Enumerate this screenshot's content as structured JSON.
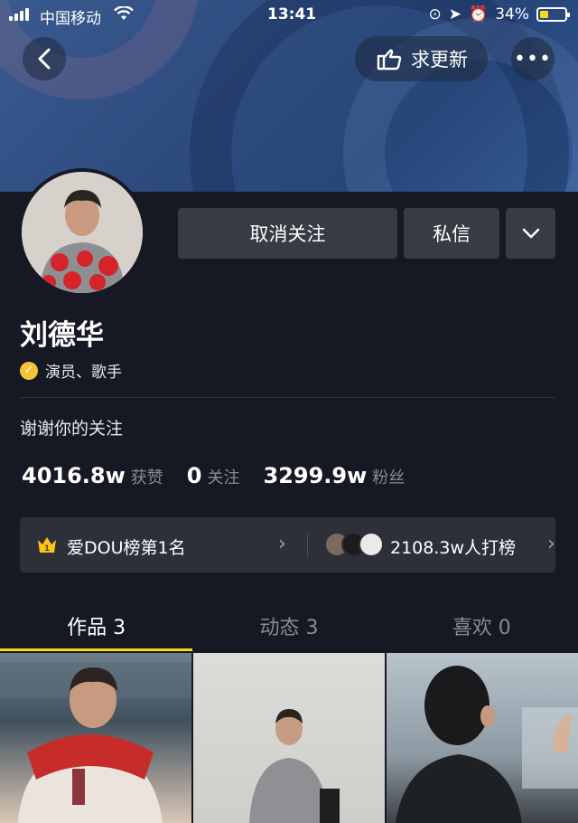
{
  "status_bar": {
    "carrier": "中国移动",
    "time": "13:41",
    "battery": "34%"
  },
  "header": {
    "update_label": "求更新"
  },
  "profile": {
    "name": "刘德华",
    "verified_label": "演员、歌手",
    "bio": "谢谢你的关注",
    "unfollow_label": "取消关注",
    "message_label": "私信"
  },
  "stats": [
    {
      "num": "4016.8w",
      "label": "获赞"
    },
    {
      "num": "0",
      "label": "关注"
    },
    {
      "num": "3299.9w",
      "label": "粉丝"
    }
  ],
  "rank": {
    "left_label": "爱DOU榜第1名",
    "crown_number": "1",
    "right_label": "2108.3w人打榜"
  },
  "tabs": [
    {
      "label": "作品 3",
      "active": true
    },
    {
      "label": "动态 3",
      "active": false
    },
    {
      "label": "喜欢 0",
      "active": false
    }
  ],
  "colors": {
    "accent": "#f7d917",
    "background": "#161823",
    "button": "#393b44",
    "verified": "#f6c338"
  }
}
